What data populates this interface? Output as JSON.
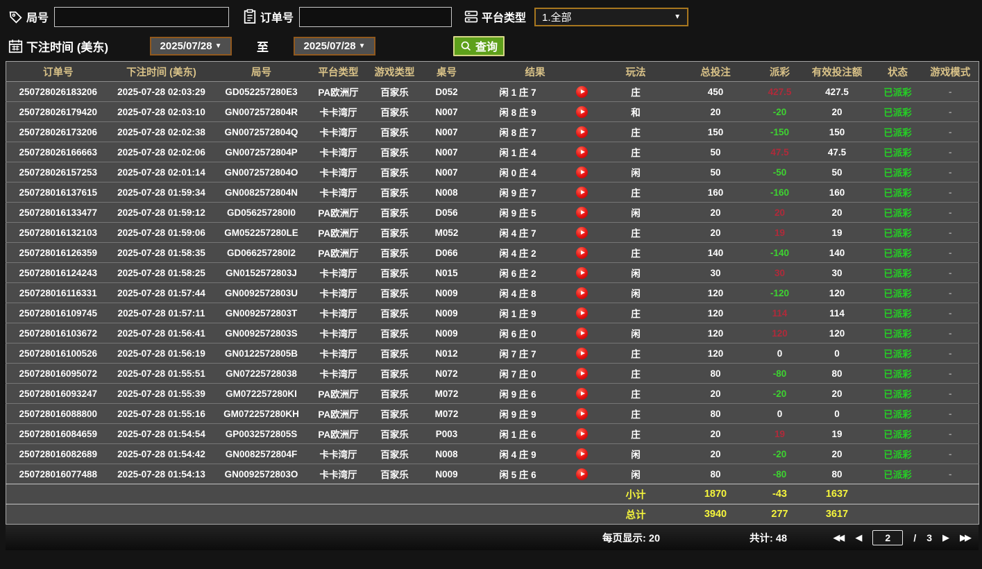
{
  "filters": {
    "game_no_label": "局号",
    "order_no_label": "订单号",
    "platform_label": "平台类型",
    "platform_value": "1.全部",
    "bet_time_label": "下注时间 (美东)",
    "date_from": "2025/07/28",
    "date_to": "2025/07/28",
    "to_label": "至",
    "query_label": "查询"
  },
  "glyphs": {
    "caret": "▼",
    "first": "◀◀",
    "prev": "◀",
    "next": "▶",
    "last": "▶▶"
  },
  "colors": {
    "header_text": "#d9c288",
    "payout_positive": "#b02a3a",
    "payout_negative": "#3ed331",
    "status_green": "#25cf25",
    "summary_yellow": "#f5f53c",
    "query_button_green": "#5ea01b",
    "date_border_orange": "#91591e",
    "play_icon_red": "#e61212"
  },
  "table": {
    "headers": [
      "订单号",
      "下注时间 (美东)",
      "局号",
      "平台类型",
      "游戏类型",
      "桌号",
      "结果",
      "玩法",
      "总投注",
      "派彩",
      "有效投注额",
      "状态",
      "游戏模式"
    ],
    "rows": [
      {
        "id": "250728026183206",
        "time": "2025-07-28 02:03:29",
        "game": "GD052257280E3",
        "hall": "PA欧洲厅",
        "type": "百家乐",
        "table": "D052",
        "result": "闲 1 庄 7",
        "bet": "庄",
        "total": "450",
        "payout": "427.5",
        "pc": "pos",
        "valid": "427.5",
        "status": "已派彩",
        "mode": "-"
      },
      {
        "id": "250728026179420",
        "time": "2025-07-28 02:03:10",
        "game": "GN0072572804R",
        "hall": "卡卡湾厅",
        "type": "百家乐",
        "table": "N007",
        "result": "闲 8 庄 9",
        "bet": "和",
        "total": "20",
        "payout": "-20",
        "pc": "neg",
        "valid": "20",
        "status": "已派彩",
        "mode": "-"
      },
      {
        "id": "250728026173206",
        "time": "2025-07-28 02:02:38",
        "game": "GN0072572804Q",
        "hall": "卡卡湾厅",
        "type": "百家乐",
        "table": "N007",
        "result": "闲 8 庄 7",
        "bet": "庄",
        "total": "150",
        "payout": "-150",
        "pc": "neg",
        "valid": "150",
        "status": "已派彩",
        "mode": "-"
      },
      {
        "id": "250728026166663",
        "time": "2025-07-28 02:02:06",
        "game": "GN0072572804P",
        "hall": "卡卡湾厅",
        "type": "百家乐",
        "table": "N007",
        "result": "闲 1 庄 4",
        "bet": "庄",
        "total": "50",
        "payout": "47.5",
        "pc": "pos",
        "valid": "47.5",
        "status": "已派彩",
        "mode": "-"
      },
      {
        "id": "250728026157253",
        "time": "2025-07-28 02:01:14",
        "game": "GN0072572804O",
        "hall": "卡卡湾厅",
        "type": "百家乐",
        "table": "N007",
        "result": "闲 0 庄 4",
        "bet": "闲",
        "total": "50",
        "payout": "-50",
        "pc": "neg",
        "valid": "50",
        "status": "已派彩",
        "mode": "-"
      },
      {
        "id": "250728016137615",
        "time": "2025-07-28 01:59:34",
        "game": "GN0082572804N",
        "hall": "卡卡湾厅",
        "type": "百家乐",
        "table": "N008",
        "result": "闲 9 庄 7",
        "bet": "庄",
        "total": "160",
        "payout": "-160",
        "pc": "neg",
        "valid": "160",
        "status": "已派彩",
        "mode": "-"
      },
      {
        "id": "250728016133477",
        "time": "2025-07-28 01:59:12",
        "game": "GD056257280I0",
        "hall": "PA欧洲厅",
        "type": "百家乐",
        "table": "D056",
        "result": "闲 9 庄 5",
        "bet": "闲",
        "total": "20",
        "payout": "20",
        "pc": "pos",
        "valid": "20",
        "status": "已派彩",
        "mode": "-"
      },
      {
        "id": "250728016132103",
        "time": "2025-07-28 01:59:06",
        "game": "GM052257280LE",
        "hall": "PA欧洲厅",
        "type": "百家乐",
        "table": "M052",
        "result": "闲 4 庄 7",
        "bet": "庄",
        "total": "20",
        "payout": "19",
        "pc": "pos",
        "valid": "19",
        "status": "已派彩",
        "mode": "-"
      },
      {
        "id": "250728016126359",
        "time": "2025-07-28 01:58:35",
        "game": "GD066257280I2",
        "hall": "PA欧洲厅",
        "type": "百家乐",
        "table": "D066",
        "result": "闲 4 庄 2",
        "bet": "庄",
        "total": "140",
        "payout": "-140",
        "pc": "neg",
        "valid": "140",
        "status": "已派彩",
        "mode": "-"
      },
      {
        "id": "250728016124243",
        "time": "2025-07-28 01:58:25",
        "game": "GN0152572803J",
        "hall": "卡卡湾厅",
        "type": "百家乐",
        "table": "N015",
        "result": "闲 6 庄 2",
        "bet": "闲",
        "total": "30",
        "payout": "30",
        "pc": "pos",
        "valid": "30",
        "status": "已派彩",
        "mode": "-"
      },
      {
        "id": "250728016116331",
        "time": "2025-07-28 01:57:44",
        "game": "GN0092572803U",
        "hall": "卡卡湾厅",
        "type": "百家乐",
        "table": "N009",
        "result": "闲 4 庄 8",
        "bet": "闲",
        "total": "120",
        "payout": "-120",
        "pc": "neg",
        "valid": "120",
        "status": "已派彩",
        "mode": "-"
      },
      {
        "id": "250728016109745",
        "time": "2025-07-28 01:57:11",
        "game": "GN0092572803T",
        "hall": "卡卡湾厅",
        "type": "百家乐",
        "table": "N009",
        "result": "闲 1 庄 9",
        "bet": "庄",
        "total": "120",
        "payout": "114",
        "pc": "pos",
        "valid": "114",
        "status": "已派彩",
        "mode": "-"
      },
      {
        "id": "250728016103672",
        "time": "2025-07-28 01:56:41",
        "game": "GN0092572803S",
        "hall": "卡卡湾厅",
        "type": "百家乐",
        "table": "N009",
        "result": "闲 6 庄 0",
        "bet": "闲",
        "total": "120",
        "payout": "120",
        "pc": "pos",
        "valid": "120",
        "status": "已派彩",
        "mode": "-"
      },
      {
        "id": "250728016100526",
        "time": "2025-07-28 01:56:19",
        "game": "GN0122572805B",
        "hall": "卡卡湾厅",
        "type": "百家乐",
        "table": "N012",
        "result": "闲 7 庄 7",
        "bet": "庄",
        "total": "120",
        "payout": "0",
        "pc": "zero",
        "valid": "0",
        "status": "已派彩",
        "mode": "-"
      },
      {
        "id": "250728016095072",
        "time": "2025-07-28 01:55:51",
        "game": "GN07225728038",
        "hall": "卡卡湾厅",
        "type": "百家乐",
        "table": "N072",
        "result": "闲 7 庄 0",
        "bet": "庄",
        "total": "80",
        "payout": "-80",
        "pc": "neg",
        "valid": "80",
        "status": "已派彩",
        "mode": "-"
      },
      {
        "id": "250728016093247",
        "time": "2025-07-28 01:55:39",
        "game": "GM072257280KI",
        "hall": "PA欧洲厅",
        "type": "百家乐",
        "table": "M072",
        "result": "闲 9 庄 6",
        "bet": "庄",
        "total": "20",
        "payout": "-20",
        "pc": "neg",
        "valid": "20",
        "status": "已派彩",
        "mode": "-"
      },
      {
        "id": "250728016088800",
        "time": "2025-07-28 01:55:16",
        "game": "GM072257280KH",
        "hall": "PA欧洲厅",
        "type": "百家乐",
        "table": "M072",
        "result": "闲 9 庄 9",
        "bet": "庄",
        "total": "80",
        "payout": "0",
        "pc": "zero",
        "valid": "0",
        "status": "已派彩",
        "mode": "-"
      },
      {
        "id": "250728016084659",
        "time": "2025-07-28 01:54:54",
        "game": "GP0032572805S",
        "hall": "PA欧洲厅",
        "type": "百家乐",
        "table": "P003",
        "result": "闲 1 庄 6",
        "bet": "庄",
        "total": "20",
        "payout": "19",
        "pc": "pos",
        "valid": "19",
        "status": "已派彩",
        "mode": "-"
      },
      {
        "id": "250728016082689",
        "time": "2025-07-28 01:54:42",
        "game": "GN0082572804F",
        "hall": "卡卡湾厅",
        "type": "百家乐",
        "table": "N008",
        "result": "闲 4 庄 9",
        "bet": "闲",
        "total": "20",
        "payout": "-20",
        "pc": "neg",
        "valid": "20",
        "status": "已派彩",
        "mode": "-"
      },
      {
        "id": "250728016077488",
        "time": "2025-07-28 01:54:13",
        "game": "GN0092572803O",
        "hall": "卡卡湾厅",
        "type": "百家乐",
        "table": "N009",
        "result": "闲 5 庄 6",
        "bet": "闲",
        "total": "80",
        "payout": "-80",
        "pc": "neg",
        "valid": "80",
        "status": "已派彩",
        "mode": "-"
      }
    ],
    "subtotal": {
      "label": "小计",
      "total": "1870",
      "payout": "-43",
      "valid": "1637"
    },
    "grand_total": {
      "label": "总计",
      "total": "3940",
      "payout": "277",
      "valid": "3617"
    }
  },
  "pagination": {
    "per_page_label": "每页显示:",
    "per_page": "20",
    "total_label": "共计:",
    "total": "48",
    "current_page": "2",
    "slash": "/",
    "total_pages": "3"
  }
}
